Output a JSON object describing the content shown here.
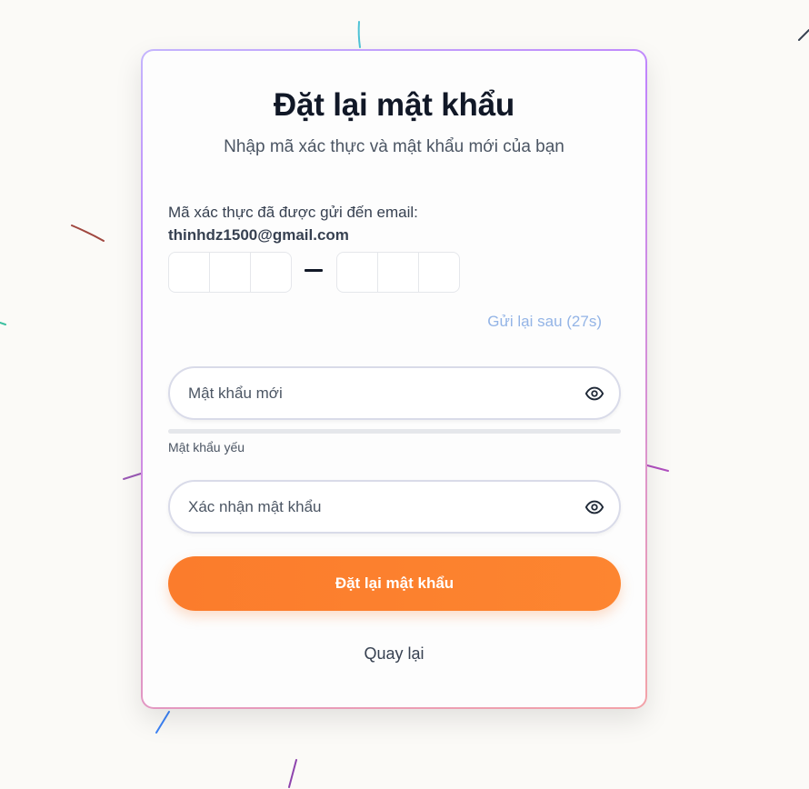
{
  "page": {
    "title": "Đặt lại mật khẩu",
    "subtitle": "Nhập mã xác thực và mật khẩu mới của bạn"
  },
  "verification": {
    "label": "Mã xác thực đã được gửi đến email:",
    "email": "thinhdz1500@gmail.com",
    "group1_values": [
      "",
      "",
      ""
    ],
    "group2_values": [
      "",
      "",
      ""
    ],
    "resend_label": "Gửi lại sau (27s)"
  },
  "new_password": {
    "placeholder": "Mật khẩu mới",
    "value": "",
    "icon": "eye-icon"
  },
  "strength": {
    "label": "Mật khẩu yếu",
    "fraction": 0
  },
  "confirm_password": {
    "placeholder": "Xác nhận mật khẩu",
    "value": "",
    "icon": "eye-icon"
  },
  "actions": {
    "submit_label": "Đặt lại mật khẩu",
    "back_label": "Quay lại"
  },
  "colors": {
    "accent": "#fb7c2c",
    "resend": "#93b4e6",
    "border_gradient": [
      "#c4b5fd",
      "#c084fc",
      "#f3a3a8"
    ]
  }
}
